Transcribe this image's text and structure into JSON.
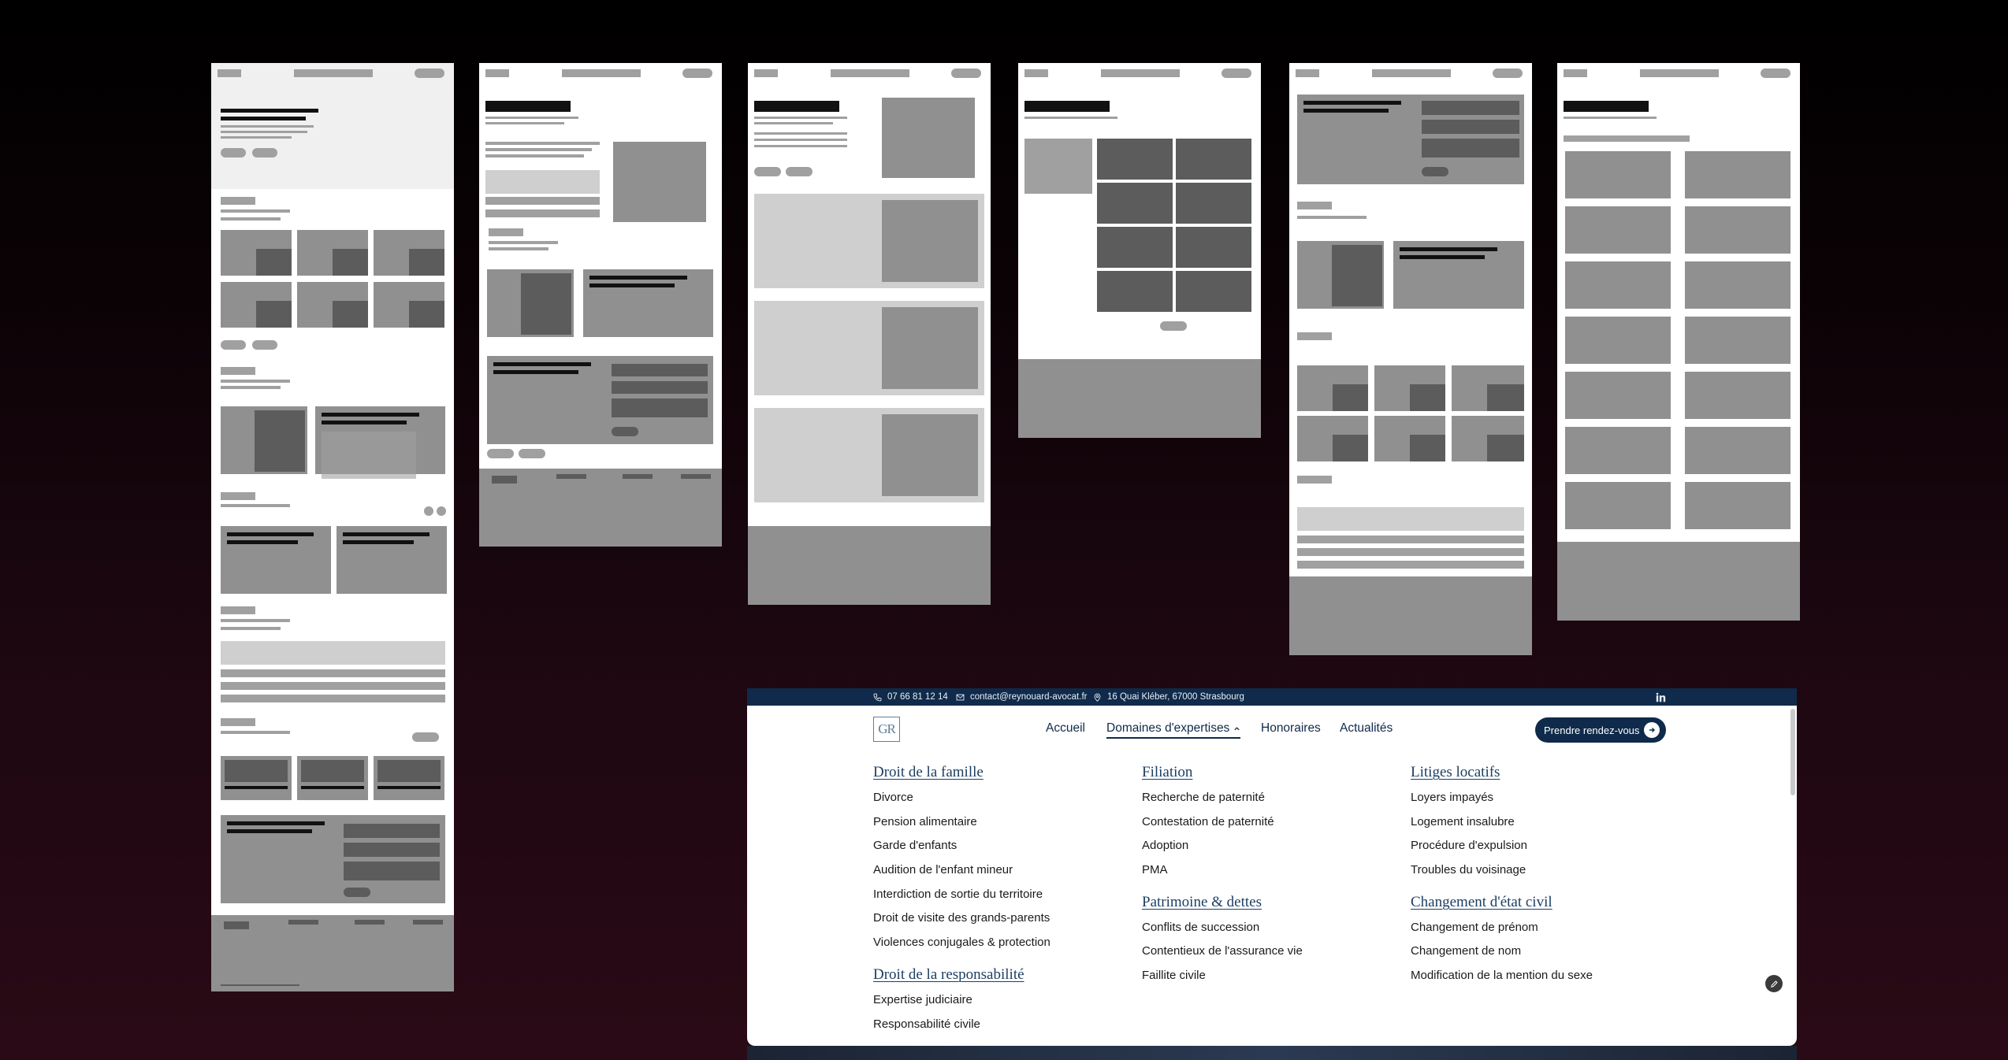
{
  "wireframes": {
    "count": 6,
    "colors": {
      "light": "#f0f0f0",
      "mid": "#cfcfcf",
      "block": "#909090",
      "dark": "#5c5c5c",
      "ink": "#111111"
    }
  },
  "site": {
    "topbar": {
      "phone": "07 66 81 12 14",
      "email": "contact@reynouard-avocat.fr",
      "address": "16 Quai Kléber, 67000 Strasbourg",
      "social_icon": "linkedin-icon",
      "background": "#0f2a4a"
    },
    "logo_text": "GR",
    "nav": {
      "home": "Accueil",
      "expertises": "Domaines d'expertises",
      "fees": "Honoraires",
      "news": "Actualités"
    },
    "cta_label": "Prendre rendez-vous",
    "menu": {
      "col1": [
        {
          "title": "Droit de la famille",
          "items": [
            "Divorce",
            "Pension alimentaire",
            "Garde d'enfants",
            "Audition de l'enfant mineur",
            "Interdiction de sortie du territoire",
            "Droit de visite des grands-parents",
            "Violences conjugales & protection"
          ]
        },
        {
          "title": "Droit de la responsabilité",
          "items": [
            "Expertise judiciaire",
            "Responsabilité civile"
          ]
        }
      ],
      "col2": [
        {
          "title": "Filiation",
          "items": [
            "Recherche de paternité",
            "Contestation de paternité",
            "Adoption",
            "PMA"
          ]
        },
        {
          "title": "Patrimoine & dettes",
          "items": [
            "Conflits de succession",
            "Contentieux de l'assurance vie",
            "Faillite civile"
          ]
        }
      ],
      "col3": [
        {
          "title": "Litiges locatifs",
          "items": [
            "Loyers impayés",
            "Logement insalubre",
            "Procédure d'expulsion",
            "Troubles du voisinage"
          ]
        },
        {
          "title": "Changement d'état civil",
          "items": [
            "Changement de prénom",
            "Changement de nom",
            "Modification de la mention du sexe"
          ]
        }
      ]
    }
  }
}
